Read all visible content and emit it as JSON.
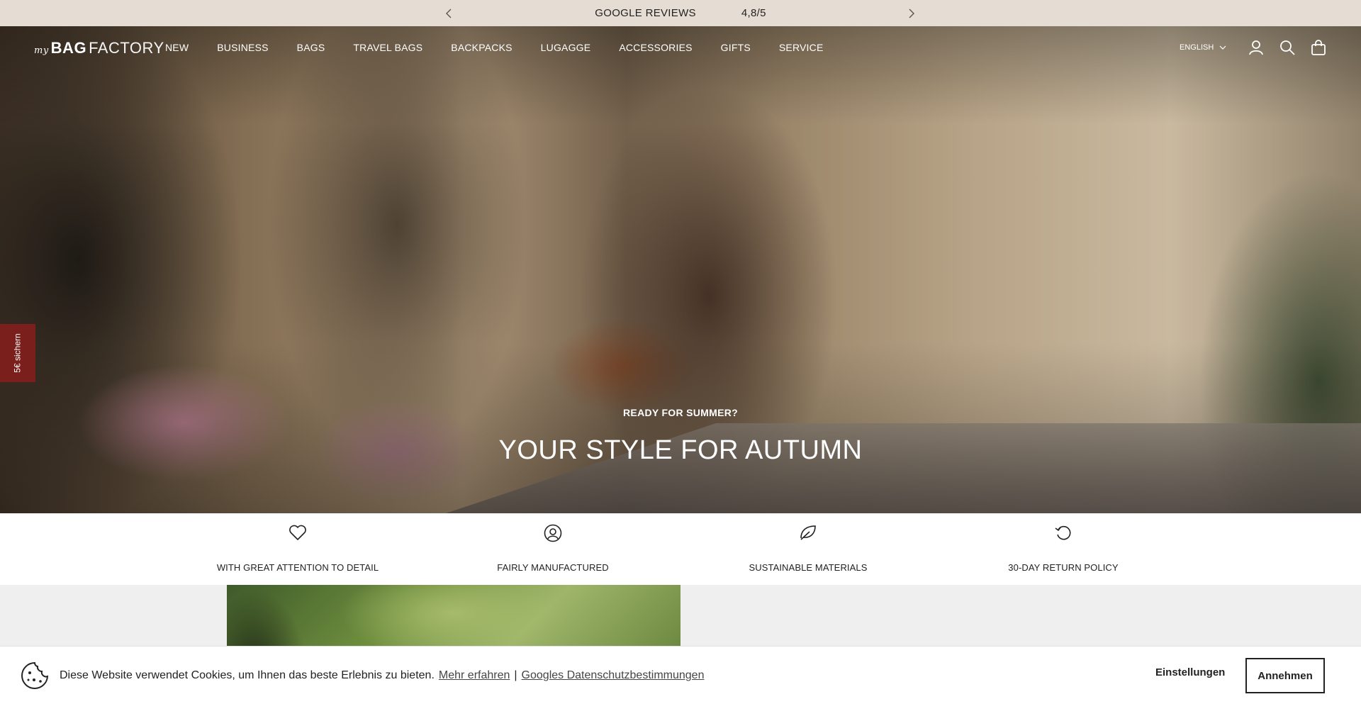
{
  "announcement": {
    "label": "GOOGLE REVIEWS",
    "rating": "4,8/5",
    "prev_icon": "chevron-left-icon",
    "next_icon": "chevron-right-icon"
  },
  "header": {
    "logo": {
      "my": "my",
      "bag": "BAG",
      "factory": "FACTORY"
    },
    "menu": [
      "NEW",
      "BUSINESS",
      "BAGS",
      "TRAVEL BAGS",
      "BACKPACKS",
      "LUGAGGE",
      "ACCESSORIES",
      "GIFTS",
      "SERVICE"
    ],
    "language": "ENGLISH",
    "icons": [
      "account-icon",
      "search-icon",
      "cart-icon"
    ]
  },
  "side_tab": {
    "label": "5€ sichern"
  },
  "hero": {
    "subtitle": "READY FOR SUMMER?",
    "title": "YOUR STYLE FOR AUTUMN"
  },
  "features": [
    {
      "label": "WITH GREAT ATTENTION TO DETAIL",
      "icon": "heart-icon"
    },
    {
      "label": "FAIRLY MANUFACTURED",
      "icon": "user-circle-icon"
    },
    {
      "label": "SUSTAINABLE MATERIALS",
      "icon": "leaf-icon"
    },
    {
      "label": "30-DAY RETURN POLICY",
      "icon": "return-icon"
    }
  ],
  "cookie": {
    "icon": "cookie-icon",
    "text": "Diese Website verwendet Cookies, um Ihnen das beste Erlebnis zu bieten.",
    "learn_more": "Mehr erfahren",
    "separator": "|",
    "privacy_link": "Googles Datenschutzbestimmungen",
    "settings_label": "Einstellungen",
    "accept_label": "Annehmen"
  },
  "colors": {
    "announcement_bg": "#e5ddd3",
    "side_tab_bg": "#7a1f1b",
    "page_bg": "#efefef"
  }
}
